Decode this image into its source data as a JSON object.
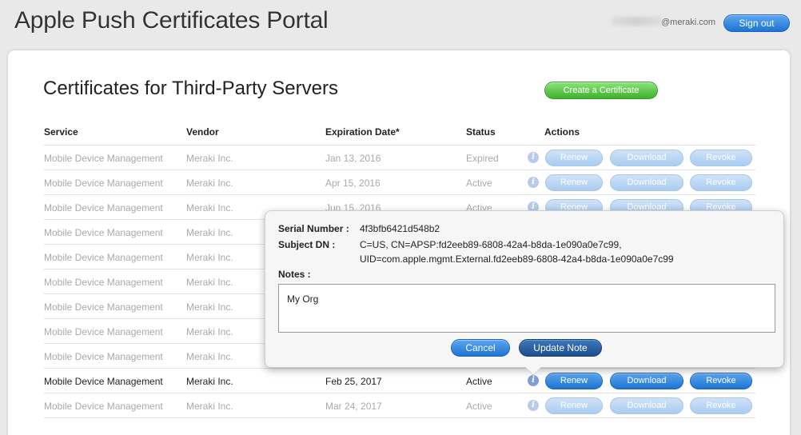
{
  "header": {
    "app_title": "Apple Push Certificates Portal",
    "user_email_suffix": "@meraki.com",
    "signout_label": "Sign out"
  },
  "main": {
    "section_title": "Certificates for Third-Party Servers",
    "create_label": "Create a Certificate",
    "columns": [
      "Service",
      "Vendor",
      "Expiration Date*",
      "Status",
      "Actions"
    ],
    "rows": [
      {
        "service": "Mobile Device Management",
        "vendor": "Meraki Inc.",
        "expiration": "Jan 13, 2016",
        "status": "Expired",
        "state": "dim"
      },
      {
        "service": "Mobile Device Management",
        "vendor": "Meraki Inc.",
        "expiration": "Apr 15, 2016",
        "status": "Active",
        "state": "dim"
      },
      {
        "service": "Mobile Device Management",
        "vendor": "Meraki Inc.",
        "expiration": "Jun 15, 2016",
        "status": "Active",
        "state": "dim"
      },
      {
        "service": "Mobile Device Management",
        "vendor": "Meraki Inc.",
        "expiration": "",
        "status": "",
        "state": "dim"
      },
      {
        "service": "Mobile Device Management",
        "vendor": "Meraki Inc.",
        "expiration": "",
        "status": "",
        "state": "dim"
      },
      {
        "service": "Mobile Device Management",
        "vendor": "Meraki Inc.",
        "expiration": "",
        "status": "",
        "state": "dim"
      },
      {
        "service": "Mobile Device Management",
        "vendor": "Meraki Inc.",
        "expiration": "",
        "status": "",
        "state": "dim"
      },
      {
        "service": "Mobile Device Management",
        "vendor": "Meraki Inc.",
        "expiration": "",
        "status": "",
        "state": "dim"
      },
      {
        "service": "Mobile Device Management",
        "vendor": "Meraki Inc.",
        "expiration": "",
        "status": "",
        "state": "dim"
      },
      {
        "service": "Mobile Device Management",
        "vendor": "Meraki Inc.",
        "expiration": "Feb 25, 2017",
        "status": "Active",
        "state": "active"
      },
      {
        "service": "Mobile Device Management",
        "vendor": "Meraki Inc.",
        "expiration": "Mar 24, 2017",
        "status": "Active",
        "state": "dim"
      }
    ],
    "actions": {
      "info_glyph": "i",
      "renew": "Renew",
      "download": "Download",
      "revoke": "Revoke"
    }
  },
  "popover": {
    "serial_label": "Serial Number :",
    "serial_value": "4f3bfb6421d548b2",
    "subject_label": "Subject DN :",
    "subject_line1": "C=US, CN=APSP:fd2eeb89-6808-42a4-b8da-1e090a0e7c99,",
    "subject_line2": "UID=com.apple.mgmt.External.fd2eeb89-6808-42a4-b8da-1e090a0e7c99",
    "notes_label": "Notes :",
    "notes_value": "My Org",
    "cancel_label": "Cancel",
    "update_label": "Update Note"
  },
  "colors": {
    "primary_blue": "#1e73d3",
    "create_green": "#3fb12d",
    "dim_text": "#aaaaaa"
  }
}
